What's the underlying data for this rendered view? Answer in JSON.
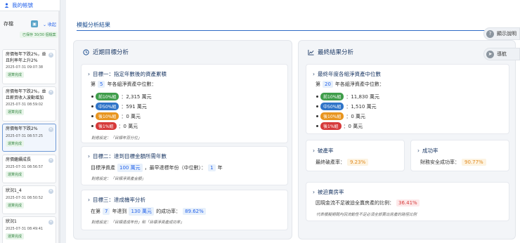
{
  "sidebar": {
    "account_label": "我的帳號",
    "store_label": "存檔",
    "collapse_label": "收起",
    "saved_badge": "已保存 30/30 個檔案",
    "scenarios": [
      {
        "title": "房價每年下跌2%，並且利率年上升2%",
        "date": "2025-07-31 09:07:38",
        "badge": "運算完成",
        "active": false
      },
      {
        "title": "房價每年下跌2%，並且薪資收入波動增加",
        "date": "2025-07-31 08:59:02",
        "badge": "運算完成",
        "active": false
      },
      {
        "title": "房價每年下跌2%",
        "date": "2025-07-31 08:57:25",
        "badge": "運算完成",
        "active": true
      },
      {
        "title": "房價繼續成長",
        "date": "2025-07-31 08:56:57",
        "badge": "運算完成",
        "active": false
      },
      {
        "title": "狀況1_4",
        "date": "2025-07-31 08:50:52",
        "badge": "運算完成",
        "active": false
      },
      {
        "title": "狀況1",
        "date": "2025-07-31 08:49:41",
        "badge": "運算完成",
        "active": false
      }
    ]
  },
  "main": {
    "page_title": "模擬分析結果",
    "help_label": "顯示說明",
    "nav_label": "導航"
  },
  "recent": {
    "title": "近期目標分析",
    "goal1": {
      "title": "目標一：指定年數後的資產累積",
      "prefix": "第",
      "year": "5",
      "suffix": "年各組淨資產中位數：",
      "rows": [
        {
          "tag": "前10%組",
          "color": "#3f9d4a",
          "value": "：2,315 萬元"
        },
        {
          "tag": "中50%組",
          "color": "#2f74c8",
          "value": "：591 萬元"
        },
        {
          "tag": "後10%組",
          "color": "#e8951f",
          "value": "：0 萬元"
        },
        {
          "tag": "後1%組",
          "color": "#d63a3a",
          "value": "：0 萬元"
        }
      ],
      "note": "對應設定：「目標年百分位」"
    },
    "goal2": {
      "title": "目標二：達到目標金額所需年數",
      "prefix": "目標淨資產",
      "amount": "100 萬元",
      "mid": "，最早達標年份（中位數）：",
      "years": "1",
      "unit": "年",
      "note": "對應設定：「目標淨資產金額」"
    },
    "goal3": {
      "title": "目標三：達成機率分析",
      "p1": "在第",
      "year": "7",
      "p2": "年達到",
      "amount": "130 萬元",
      "p3": "的成功率：",
      "rate": "89.62%",
      "note": "對應設定：「目標達成年份」和「目標淨資產成功率」"
    }
  },
  "final": {
    "title": "最終結果分析",
    "median": {
      "title": "最終年度各組淨資產中位數",
      "prefix": "第",
      "year": "20",
      "suffix": "年各組淨資產中位數：",
      "rows": [
        {
          "tag": "前10%組",
          "color": "#3f9d4a",
          "value": "：11,830 萬元"
        },
        {
          "tag": "中50%組",
          "color": "#2f74c8",
          "value": "：1,510 萬元"
        },
        {
          "tag": "後10%組",
          "color": "#e8951f",
          "value": "：0 萬元"
        },
        {
          "tag": "後1%組",
          "color": "#d63a3a",
          "value": "：0 萬元"
        }
      ]
    },
    "bankrupt": {
      "title": "破產率",
      "label": "最終破產率：",
      "value": "9.23%"
    },
    "success": {
      "title": "成功率",
      "label": "財務安全成功率：",
      "value": "90.77%"
    },
    "forced": {
      "title": "被迫賣房率",
      "label": "因現金流不足被迫全賣房產的比例：",
      "value": "36.41%",
      "note": "代表模擬期間內因流動性不足必須全部賣出房產的路徑比例"
    }
  },
  "colors": {
    "accent": "#2563eb",
    "title_blue": "#1d4f91",
    "green": "#3f9d4a",
    "orange": "#e8951f",
    "red": "#d63a3a"
  }
}
